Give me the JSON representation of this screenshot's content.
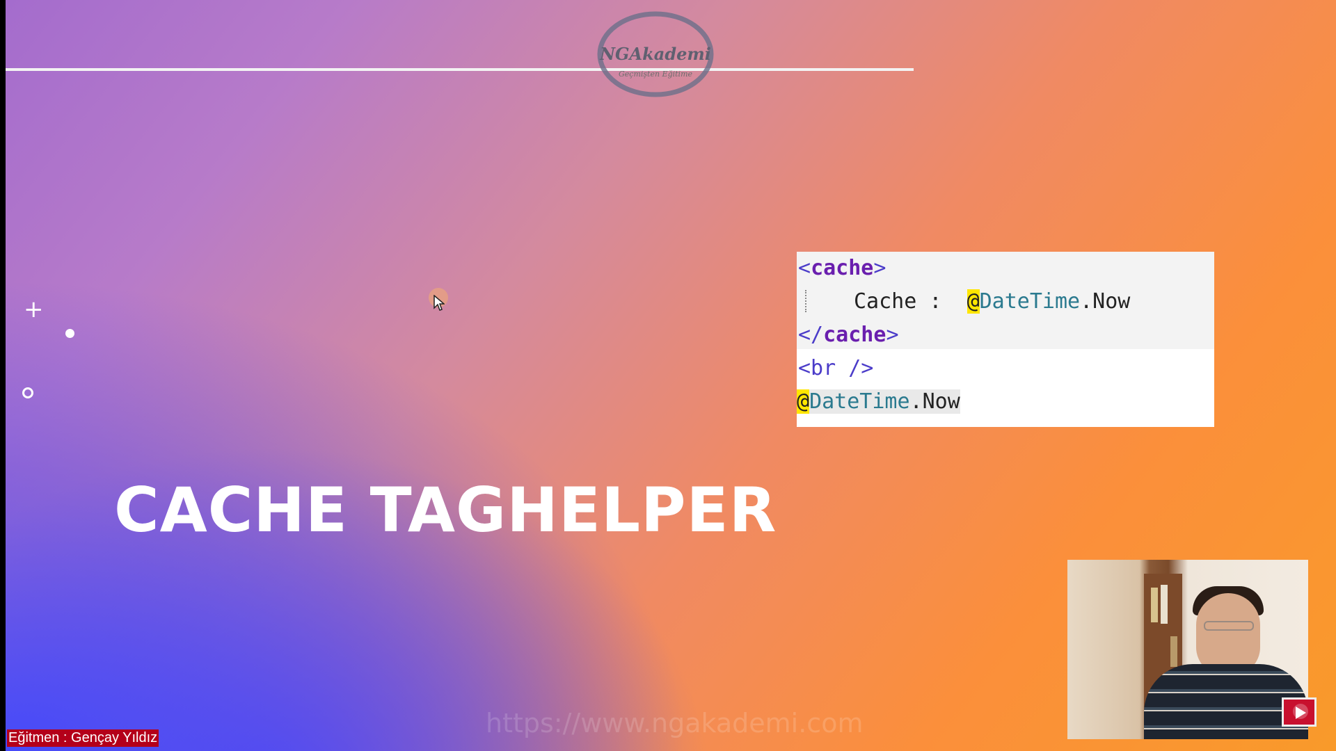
{
  "logo": {
    "name": "NGAkademi",
    "tagline": "Geçmişten Eğitime"
  },
  "slide": {
    "title": "CACHE TAGHELPER"
  },
  "code_snippet": {
    "line1": "<cache>",
    "line2_text": "Cache :  ",
    "line2_at": "@",
    "line2_expr": "DateTime",
    "line2_member": ".Now",
    "line3": "</cache>",
    "line4": "<br />",
    "line5_at": "@",
    "line5_expr": "DateTime",
    "line5_member": ".Now"
  },
  "watermark_url": "https://www.ngakademi.com",
  "instructor_label": "Eğitmen : Gençay Yıldız",
  "colors": {
    "gradient_start": "#a46ccd",
    "gradient_end": "#f99a2a",
    "accent_blue": "#3c46ff",
    "code_tag": "#6a1fae"
  },
  "icons": {
    "plus": "plus-icon",
    "dot": "dot-icon",
    "ring": "ring-icon",
    "play": "youtube-play-icon"
  }
}
